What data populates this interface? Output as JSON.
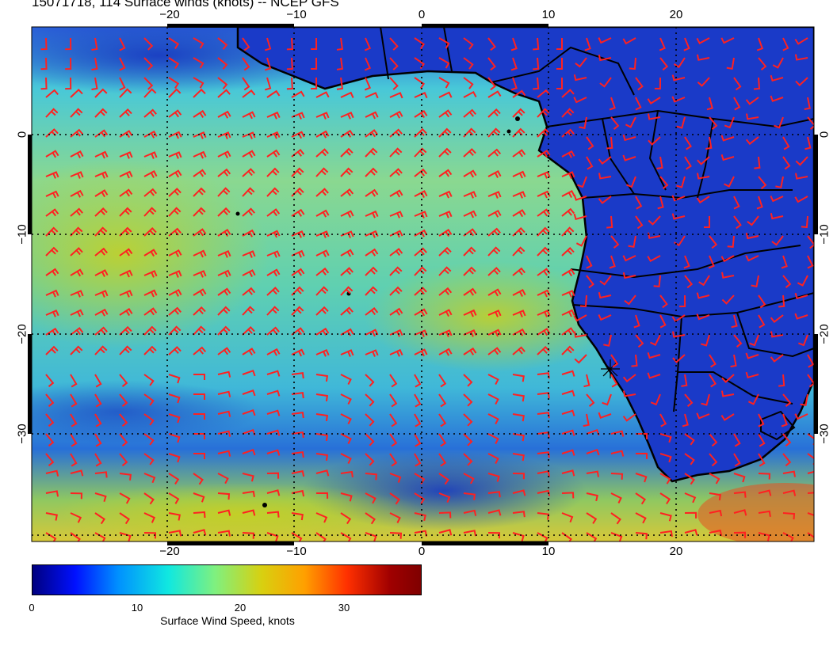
{
  "title": "15071718, 114 Surface winds (knots) -- NCEP GFS",
  "x_ticks": [
    "−20",
    "−10",
    "0",
    "10",
    "20"
  ],
  "y_ticks": [
    "0",
    "−10",
    "−20",
    "−30"
  ],
  "colorbar": {
    "title": "Surface Wind Speed, knots",
    "labels": [
      "0",
      "10",
      "20",
      "30"
    ],
    "range": [
      0,
      37
    ],
    "stops": [
      "#00007f",
      "#0010ff",
      "#0090ff",
      "#10e8e0",
      "#7ff07f",
      "#d8d010",
      "#ffa000",
      "#ff3000",
      "#a00000",
      "#7f0000"
    ]
  },
  "colors": {
    "barb": "#ff2020",
    "land": "#1030c8",
    "ocean_calm": "#2878e0",
    "ocean_mid": "#20c0d0",
    "ocean_fast": "#a8d040",
    "coast": "#000000"
  }
}
